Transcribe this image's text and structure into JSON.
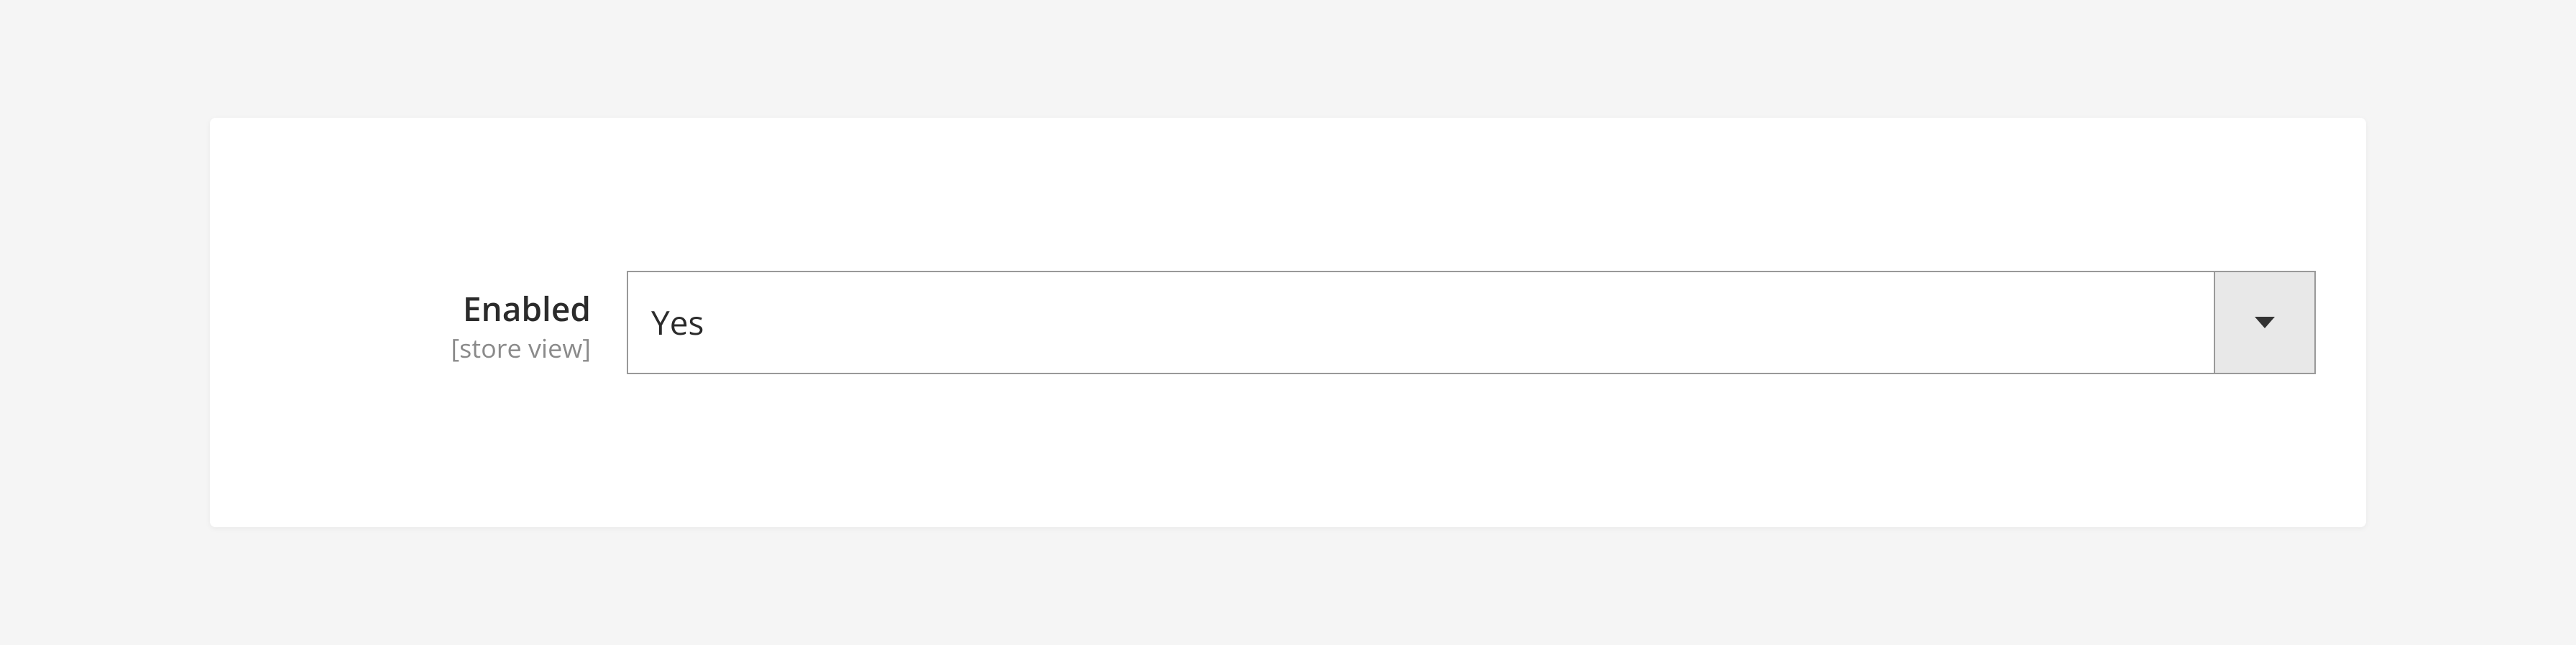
{
  "form": {
    "enabled": {
      "label": "Enabled",
      "scope": "[store view]",
      "value": "Yes"
    }
  }
}
